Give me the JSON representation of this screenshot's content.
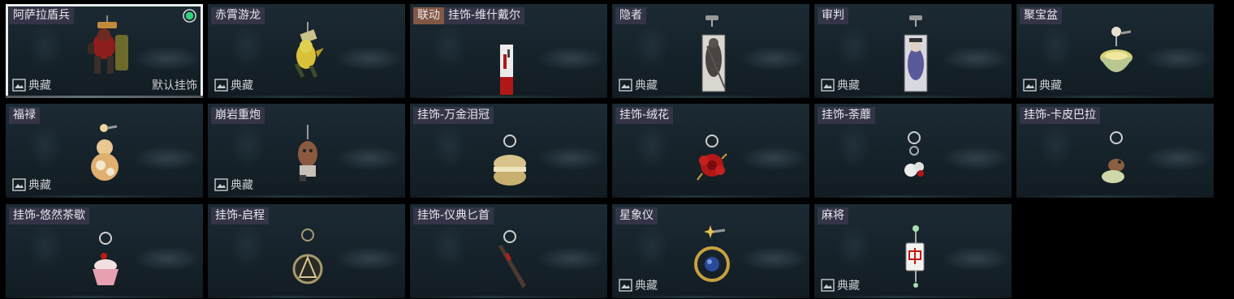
{
  "cards": [
    {
      "tag": "",
      "name": "阿萨拉盾兵",
      "rarity": "典藏",
      "default_label": "默认挂饰",
      "selected": true
    },
    {
      "tag": "",
      "name": "赤霄游龙",
      "rarity": "典藏"
    },
    {
      "tag": "联动",
      "name": "挂饰-维什戴尔",
      "rarity": ""
    },
    {
      "tag": "",
      "name": "隐者",
      "rarity": "典藏"
    },
    {
      "tag": "",
      "name": "审判",
      "rarity": "典藏"
    },
    {
      "tag": "",
      "name": "聚宝盆",
      "rarity": "典藏"
    },
    {
      "tag": "",
      "name": "福禄",
      "rarity": "典藏"
    },
    {
      "tag": "",
      "name": "崩岩重炮",
      "rarity": "典藏"
    },
    {
      "tag": "",
      "name": "挂饰-万金泪冠",
      "rarity": ""
    },
    {
      "tag": "",
      "name": "挂饰-绒花",
      "rarity": ""
    },
    {
      "tag": "",
      "name": "挂饰-荼蘼",
      "rarity": ""
    },
    {
      "tag": "",
      "name": "挂饰-卡皮巴拉",
      "rarity": ""
    },
    {
      "tag": "",
      "name": "挂饰-悠然茶歇",
      "rarity": ""
    },
    {
      "tag": "",
      "name": "挂饰-启程",
      "rarity": ""
    },
    {
      "tag": "",
      "name": "挂饰-仪典匕首",
      "rarity": ""
    },
    {
      "tag": "",
      "name": "星象仪",
      "rarity": "典藏"
    },
    {
      "tag": "",
      "name": "麻将",
      "rarity": "典藏"
    }
  ],
  "colors": {
    "selected_outline": "#e8edf0",
    "equipped_dot": "#2fd27a",
    "tag_bg": "#946048",
    "name_bg": "#3a384e"
  }
}
